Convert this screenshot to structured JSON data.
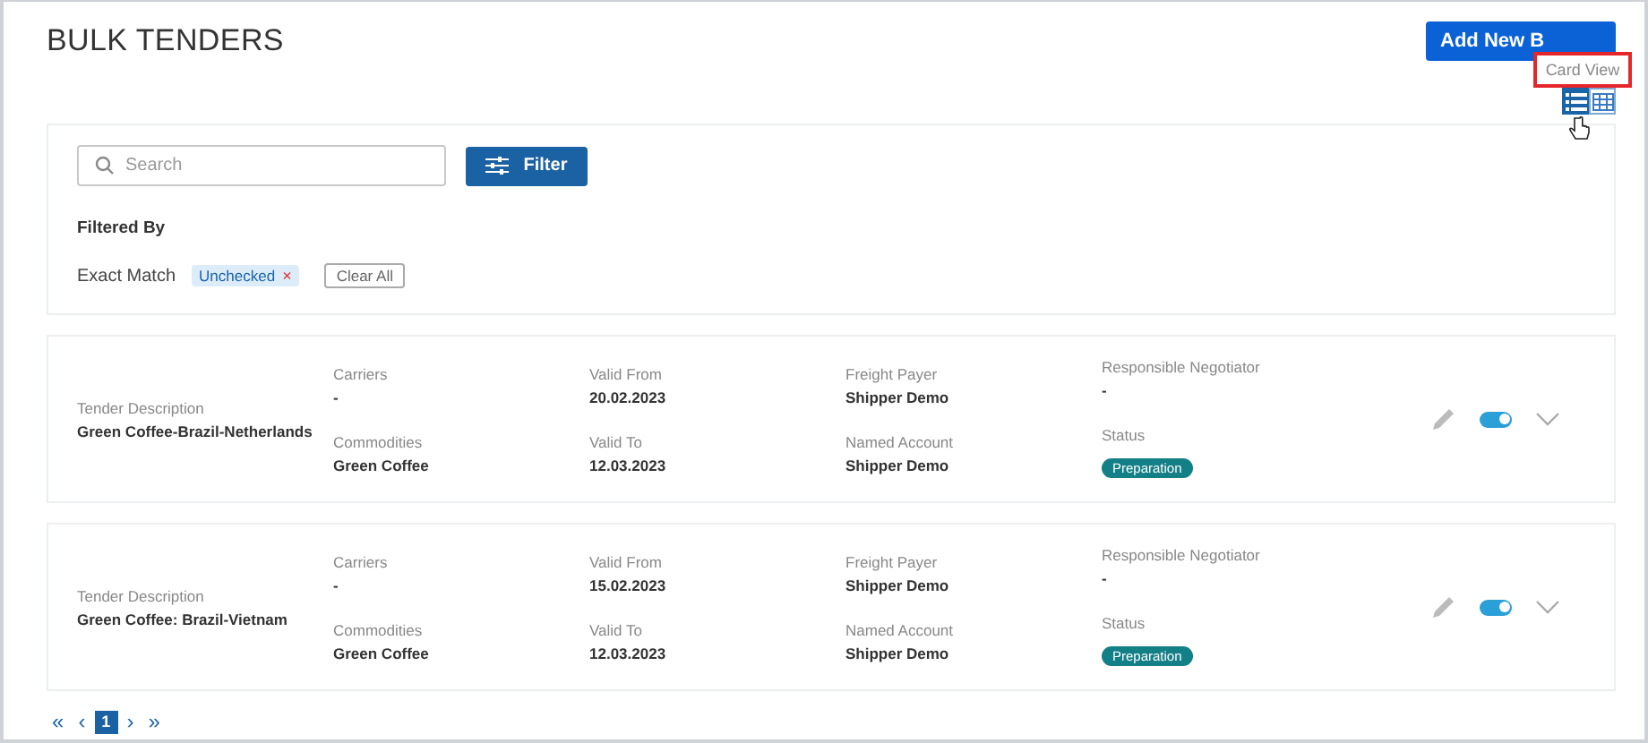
{
  "title": "BULK TENDERS",
  "add_button": "Add New B",
  "tooltip": "Card View",
  "views": [
    {
      "kind": "list",
      "selected": true
    },
    {
      "kind": "table",
      "selected": false
    }
  ],
  "search": {
    "placeholder": "Search"
  },
  "filter_button": "Filter",
  "filtered_by": {
    "heading": "Filtered By",
    "label": "Exact Match",
    "chips": [
      {
        "text": "Unchecked",
        "remove": "×"
      }
    ],
    "clear": "Clear All"
  },
  "tenders": [
    {
      "description_label": "Tender Description",
      "description": "Green Coffee-Brazil-Netherlands",
      "columns": [
        [
          {
            "label": "Carriers",
            "value": "-"
          },
          {
            "label": "Commodities",
            "value": "Green Coffee"
          }
        ],
        [
          {
            "label": "Valid From",
            "value": "20.02.2023"
          },
          {
            "label": "Valid To",
            "value": "12.03.2023"
          }
        ],
        [
          {
            "label": "Freight Payer",
            "value": "Shipper Demo"
          },
          {
            "label": "Named Account",
            "value": "Shipper Demo"
          }
        ],
        [
          {
            "label": "Responsible Negotiator",
            "value": "-"
          },
          {
            "label": "Status",
            "value": "Preparation",
            "kind": "badge"
          }
        ]
      ],
      "on": true
    },
    {
      "description_label": "Tender Description",
      "description": "Green Coffee: Brazil-Vietnam",
      "columns": [
        [
          {
            "label": "Carriers",
            "value": "-"
          },
          {
            "label": "Commodities",
            "value": "Green Coffee"
          }
        ],
        [
          {
            "label": "Valid From",
            "value": "15.02.2023"
          },
          {
            "label": "Valid To",
            "value": "12.03.2023"
          }
        ],
        [
          {
            "label": "Freight Payer",
            "value": "Shipper Demo"
          },
          {
            "label": "Named Account",
            "value": "Shipper Demo"
          }
        ],
        [
          {
            "label": "Responsible Negotiator",
            "value": "-"
          },
          {
            "label": "Status",
            "value": "Preparation",
            "kind": "badge"
          }
        ]
      ],
      "on": true
    }
  ],
  "pagination": [
    {
      "text": "«",
      "kind": "nav",
      "selected": false
    },
    {
      "text": "‹",
      "kind": "nav",
      "selected": false
    },
    {
      "text": "1",
      "kind": "page",
      "selected": true
    },
    {
      "text": "›",
      "kind": "nav",
      "selected": false
    },
    {
      "text": "»",
      "kind": "nav",
      "selected": false
    }
  ]
}
